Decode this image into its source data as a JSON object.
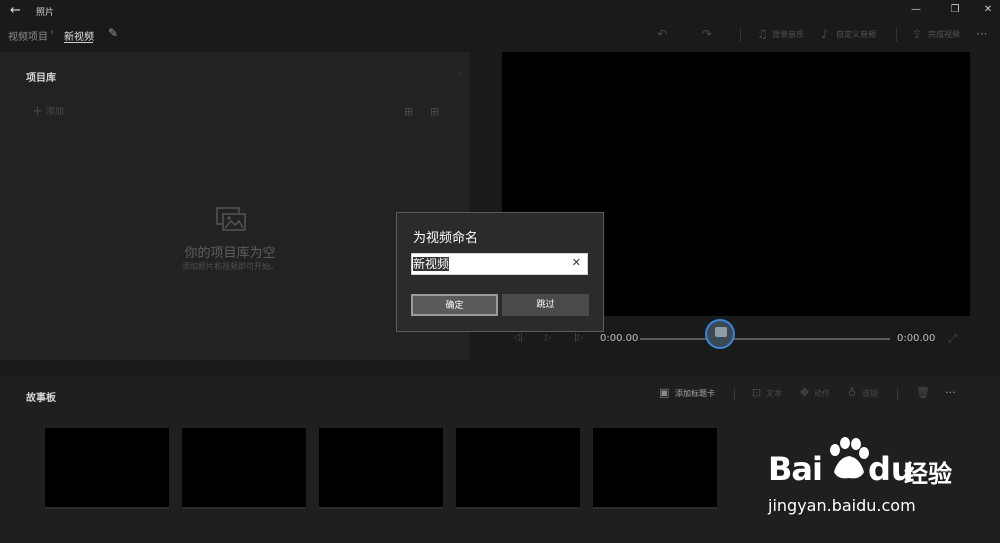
{
  "app": {
    "title": "照片",
    "back_glyph": "←",
    "window_controls": {
      "minimize": "—",
      "maximize": "❐",
      "close": "✕"
    }
  },
  "header": {
    "breadcrumb_root": "视频项目",
    "breadcrumb_sep": "›",
    "breadcrumb_current": "新视频",
    "edit_icon": "pencil-icon",
    "toolbar": {
      "undo_icon": "↶",
      "redo_icon": "↷",
      "bg_music": "背景音乐",
      "custom_audio": "自定义音频",
      "finish_video": "完成视频",
      "more": "···"
    }
  },
  "library": {
    "title": "项目库",
    "collapse_glyph": "‹",
    "add_label": "添加",
    "empty_title": "你的项目库为空",
    "empty_subtitle": "添加照片和视频即可开始。"
  },
  "player": {
    "current_time": "0:00.00",
    "total_time": "0:00.00",
    "progress": 0.32
  },
  "storyboard": {
    "title": "故事板",
    "add_title_card": "添加标题卡",
    "text": "文本",
    "motion": "动作",
    "filters": "滤镜",
    "more": "···",
    "clip_count": 5
  },
  "dialog": {
    "title": "为视频命名",
    "input_value": "新视频",
    "clear_glyph": "✕",
    "ok_label": "确定",
    "skip_label": "跳过"
  },
  "watermark": {
    "bai": "Bai",
    "du": "du",
    "jingyan": "经验",
    "url": "jingyan.baidu.com"
  },
  "colors": {
    "background": "#1a1a1a",
    "panel": "#222222",
    "accent": "#3a85d8",
    "dialog": "#2b2b2b"
  }
}
